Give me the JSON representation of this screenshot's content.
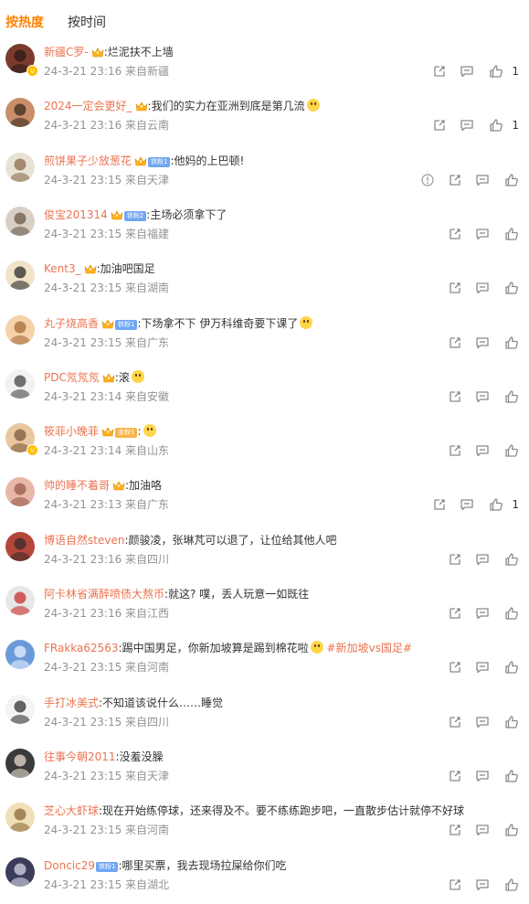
{
  "tabs": {
    "hot_label": "按热度",
    "time_label": "按时间"
  },
  "colors": {
    "accent": "#ff8200",
    "username": "#eb7350",
    "meta": "#939393"
  },
  "comments": [
    {
      "user": "新疆C罗-",
      "text": ":烂泥扶不上墙",
      "meta": "24-3-21 23:16 来自新疆",
      "likes": "1",
      "verified": true,
      "crown": true,
      "badge": "",
      "emoji": false,
      "topic": "",
      "report": false
    },
    {
      "user": "2024一定会更好_",
      "text": ":我们的实力在亚洲到底是第几流",
      "meta": "24-3-21 23:16 来自云南",
      "likes": "1",
      "verified": false,
      "crown": true,
      "badge": "",
      "emoji": true,
      "topic": "",
      "report": false
    },
    {
      "user": "煎饼果子少放葱花",
      "text": ":他妈的上巴顿!",
      "meta": "24-3-21 23:15 来自天津",
      "likes": "",
      "verified": false,
      "crown": true,
      "badge": "铁粉1",
      "emoji": false,
      "topic": "",
      "report": true
    },
    {
      "user": "俊宝201314",
      "text": ":主场必须拿下了",
      "meta": "24-3-21 23:15 来自福建",
      "likes": "",
      "verified": false,
      "crown": true,
      "badge": "铁粉2",
      "emoji": false,
      "topic": "",
      "report": false
    },
    {
      "user": "Kent3_",
      "text": ":加油吧国足",
      "meta": "24-3-21 23:15 来自湖南",
      "likes": "",
      "verified": false,
      "crown": true,
      "badge": "",
      "emoji": false,
      "topic": "",
      "report": false
    },
    {
      "user": "丸子烧高香",
      "text": ":下场拿不下 伊万科维奇要下课了",
      "meta": "24-3-21 23:15 来自广东",
      "likes": "",
      "verified": false,
      "crown": true,
      "badge": "铁粉1",
      "emoji": true,
      "topic": "",
      "report": false
    },
    {
      "user": "PDC氖氖氖",
      "text": ":滚",
      "meta": "24-3-21 23:14 来自安徽",
      "likes": "",
      "verified": false,
      "crown": true,
      "badge": "",
      "emoji": true,
      "topic": "",
      "report": false
    },
    {
      "user": "筱菲小晚菲",
      "text": ":",
      "meta": "24-3-21 23:14 来自山东",
      "likes": "",
      "verified": true,
      "crown": true,
      "badge": "金粉1",
      "emoji": true,
      "topic": "",
      "report": false
    },
    {
      "user": "帅的睡不着哥",
      "text": ":加油咯",
      "meta": "24-3-21 23:13 来自广东",
      "likes": "1",
      "verified": false,
      "crown": true,
      "badge": "",
      "emoji": false,
      "topic": "",
      "report": false
    },
    {
      "user": "博语自然steven",
      "text": ":颜骏凌，张琳芃可以退了，让位给其他人吧",
      "meta": "24-3-21 23:16 来自四川",
      "likes": "",
      "verified": false,
      "crown": false,
      "badge": "",
      "emoji": false,
      "topic": "",
      "report": false
    },
    {
      "user": "阿卡林省满醉喷债大熬币",
      "text": ":就这? 噗，丢人玩意一如既往",
      "meta": "24-3-21 23:16 来自江西",
      "likes": "",
      "verified": false,
      "crown": false,
      "badge": "",
      "emoji": false,
      "topic": "",
      "report": false
    },
    {
      "user": "FRakka62563",
      "text": ":踢中国男足，你新加坡算是踢到棉花啦",
      "meta": "24-3-21 23:15 来自河南",
      "likes": "",
      "verified": false,
      "crown": false,
      "badge": "",
      "emoji": true,
      "topic": "#新加坡vs国足#",
      "report": false
    },
    {
      "user": "手打冰美式",
      "text": ":不知道该说什么……睡觉",
      "meta": "24-3-21 23:15 来自四川",
      "likes": "",
      "verified": false,
      "crown": false,
      "badge": "",
      "emoji": false,
      "topic": "",
      "report": false
    },
    {
      "user": "往事今朝2011",
      "text": ":没羞没臊",
      "meta": "24-3-21 23:15 来自天津",
      "likes": "",
      "verified": false,
      "crown": false,
      "badge": "",
      "emoji": false,
      "topic": "",
      "report": false
    },
    {
      "user": "芝心大虾球",
      "text": ":现在开始练停球，还来得及不。要不练练跑步吧，一直散步估计就停不好球",
      "meta": "24-3-21 23:15 来自河南",
      "likes": "",
      "verified": false,
      "crown": false,
      "badge": "",
      "emoji": false,
      "topic": "",
      "report": false
    },
    {
      "user": "Doncic29",
      "text": ":哪里买票，我去现场拉屎给你们吃",
      "meta": "24-3-21 23:15 来自湖北",
      "likes": "",
      "verified": false,
      "crown": false,
      "badge": "铁粉1",
      "emoji": false,
      "topic": "",
      "report": false
    }
  ]
}
